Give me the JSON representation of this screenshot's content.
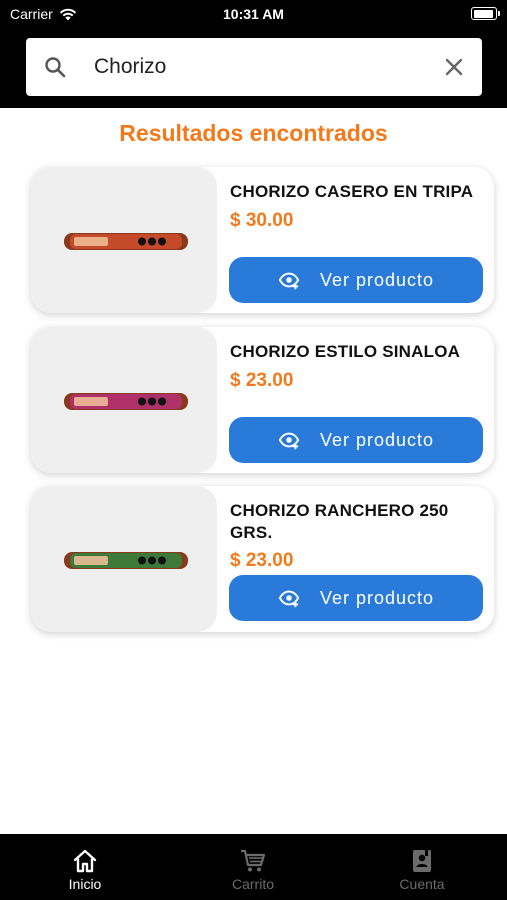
{
  "status_bar": {
    "carrier": "Carrier",
    "time": "10:31 AM",
    "battery_level": 0.92
  },
  "search": {
    "query": "Chorizo"
  },
  "results": {
    "title": "Resultados encontrados",
    "items": [
      {
        "name": "CHORIZO CASERO EN TRIPA",
        "price": "$ 30.00",
        "button_label": "Ver producto",
        "image_accent": "#c44a2a"
      },
      {
        "name": "CHORIZO ESTILO SINALOA",
        "price": "$ 23.00",
        "button_label": "Ver producto",
        "image_accent": "#b0306a"
      },
      {
        "name": "CHORIZO RANCHERO 250 GRS.",
        "price": "$ 23.00",
        "button_label": "Ver producto",
        "image_accent": "#3d7a3a"
      }
    ]
  },
  "tab_bar": {
    "tabs": [
      {
        "label": "Inicio",
        "icon": "home-icon",
        "active": true
      },
      {
        "label": "Carrito",
        "icon": "cart-icon",
        "active": false
      },
      {
        "label": "Cuenta",
        "icon": "account-book-icon",
        "active": false
      }
    ]
  },
  "colors": {
    "accent": "#F27A1A",
    "button": "#2A7BD9",
    "active_tab": "#ffffff",
    "inactive_tab": "#6b6b6b"
  }
}
